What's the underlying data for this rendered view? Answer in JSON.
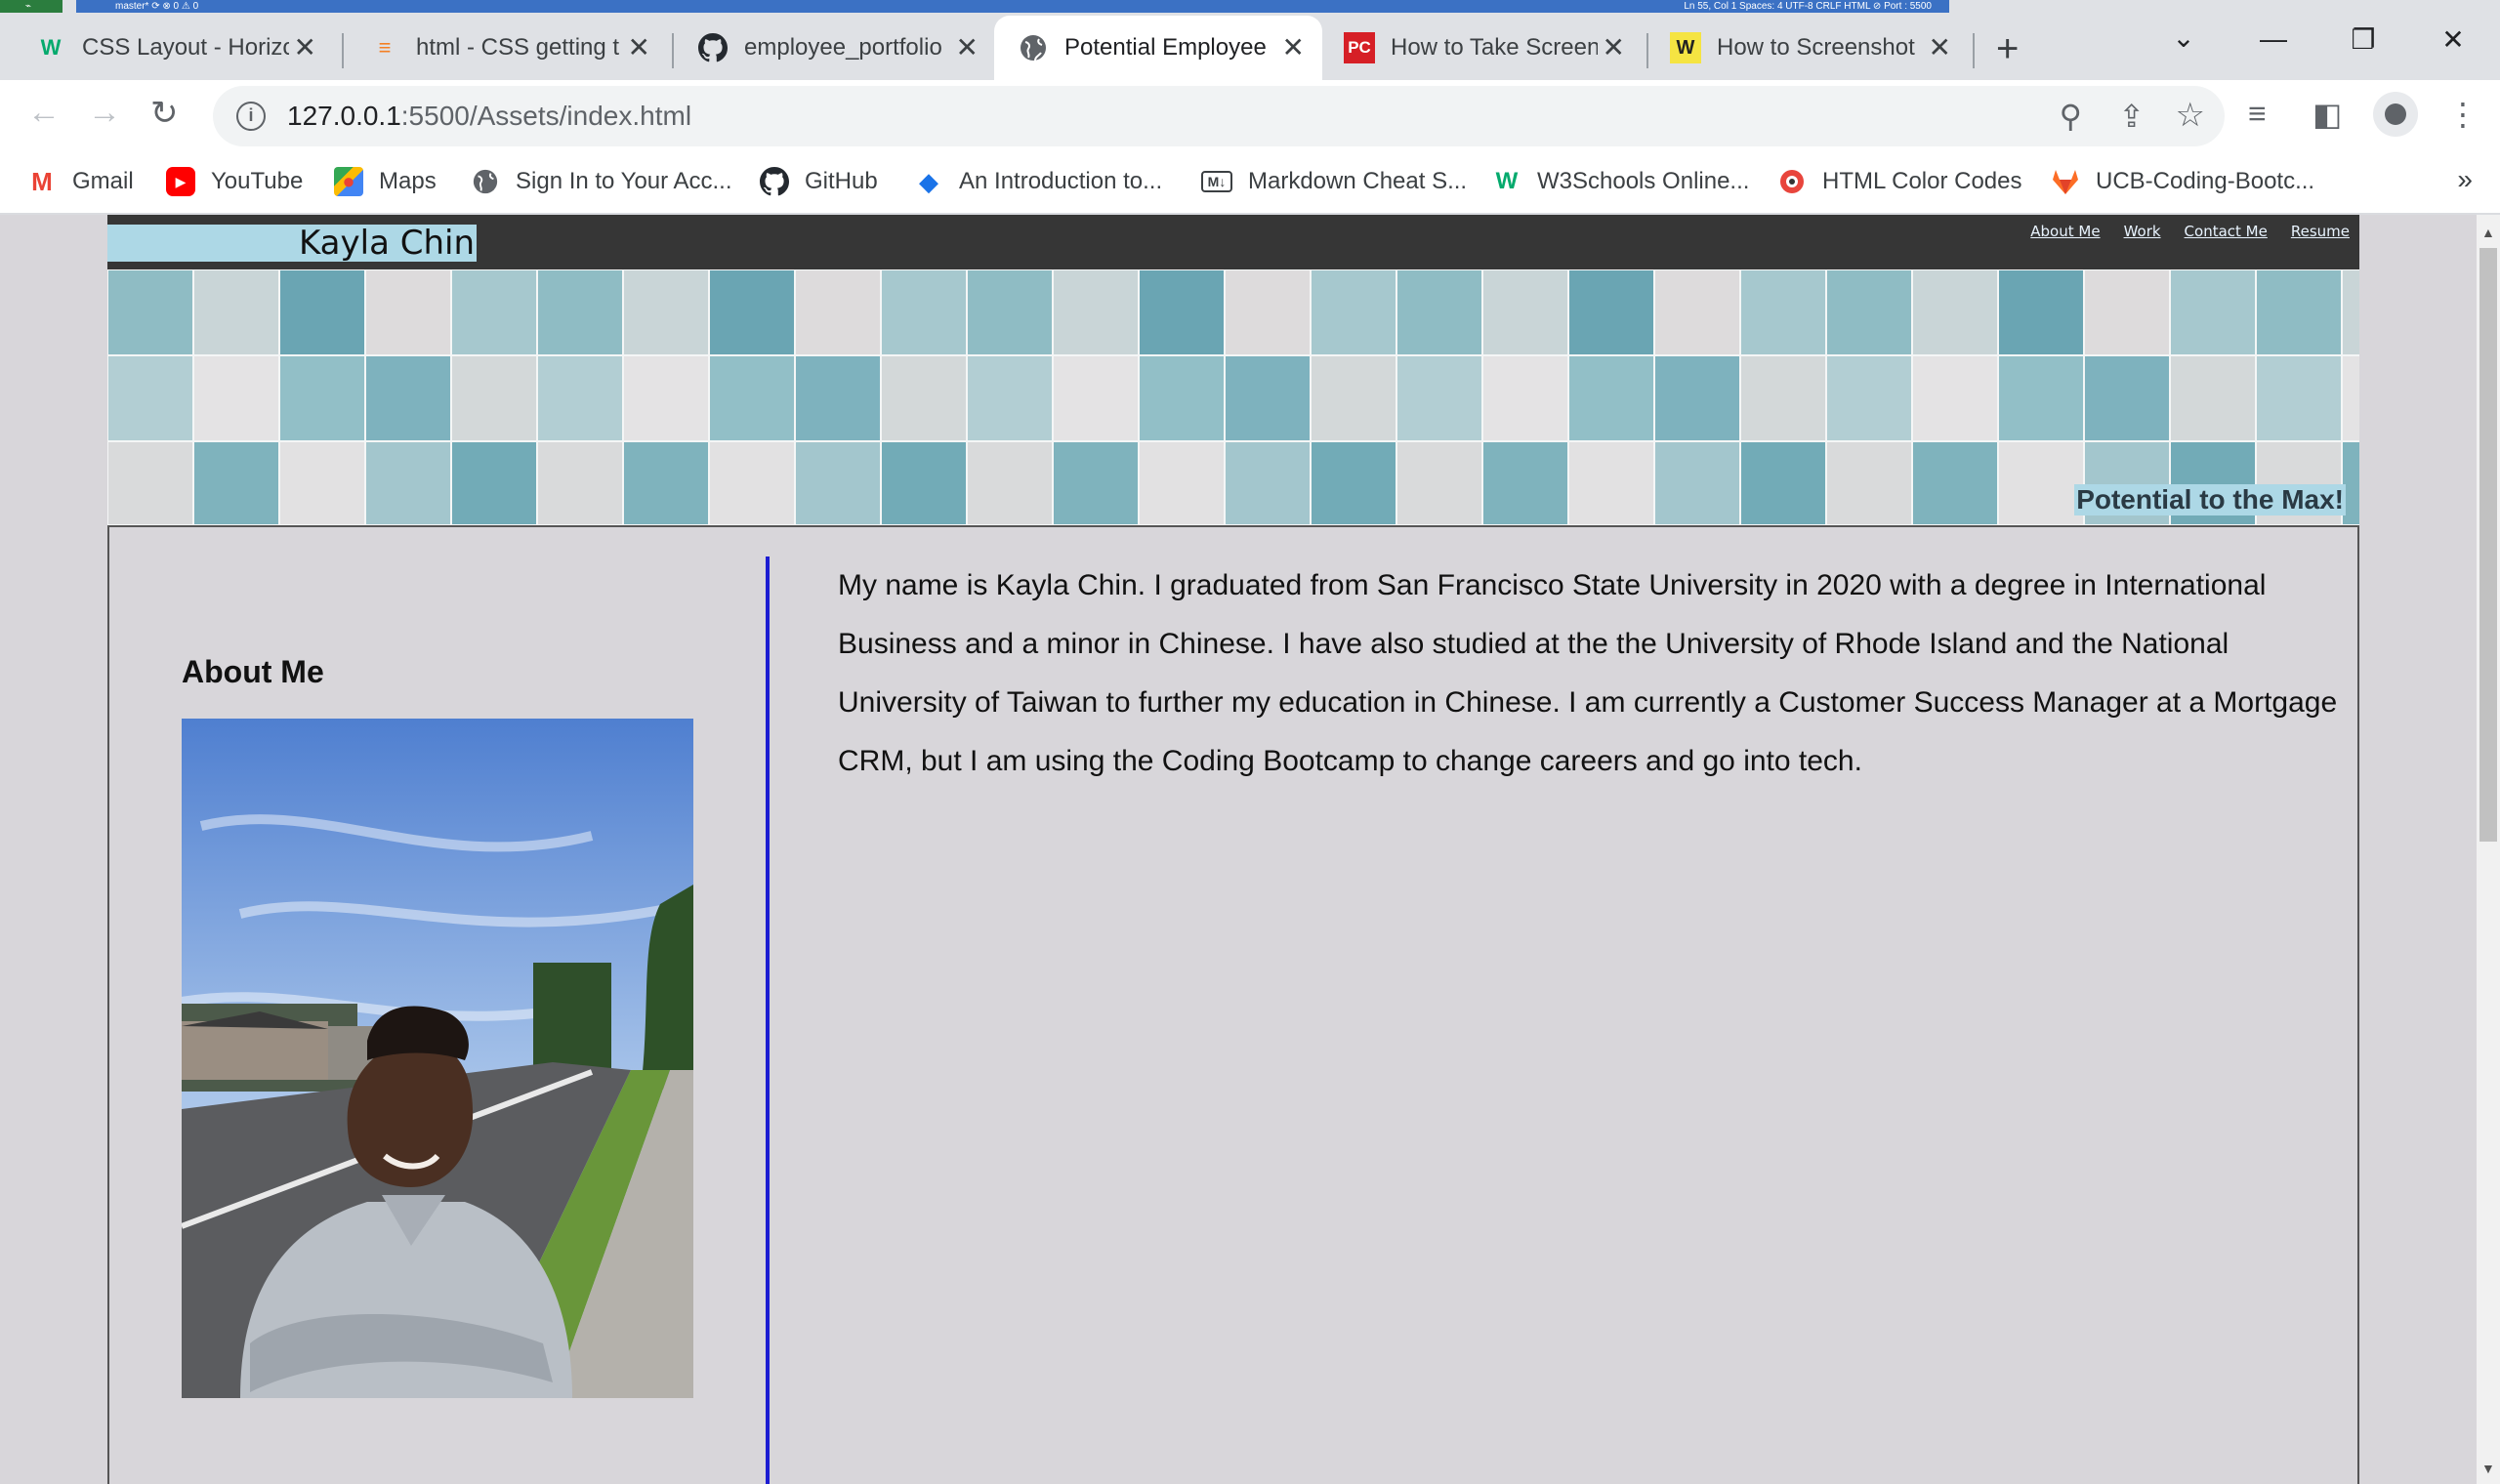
{
  "editor_status": {
    "left_branch": "master*",
    "left_counts": "⟳  ⊗ 0 ⚠ 0",
    "right": "Ln 55, Col 1    Spaces: 4    UTF-8    CRLF    HTML    ⊘ Port : 5500"
  },
  "tabs": [
    {
      "title": "CSS Layout - Horizo",
      "icon": "w3schools-icon",
      "active": false
    },
    {
      "title": "html - CSS getting t",
      "icon": "stackoverflow-icon",
      "active": false
    },
    {
      "title": "employee_portfolio",
      "icon": "github-icon",
      "active": false
    },
    {
      "title": "Potential Employee",
      "icon": "globe-icon",
      "active": true
    },
    {
      "title": "How to Take Screen",
      "icon": "pcmag-icon",
      "active": false
    },
    {
      "title": "How to Screenshot",
      "icon": "wikihow-icon",
      "active": false
    }
  ],
  "address": {
    "host": "127.0.0.1",
    "rest": ":5500/Assets/index.html"
  },
  "bookmarks": [
    {
      "label": "Gmail",
      "icon": "gmail-icon"
    },
    {
      "label": "YouTube",
      "icon": "youtube-icon"
    },
    {
      "label": "Maps",
      "icon": "maps-icon"
    },
    {
      "label": "Sign In to Your Acc...",
      "icon": "globe-icon"
    },
    {
      "label": "GitHub",
      "icon": "github-icon"
    },
    {
      "label": "An Introduction to...",
      "icon": "bookmark-icon"
    },
    {
      "label": "Markdown Cheat S...",
      "icon": "markdown-icon"
    },
    {
      "label": "W3Schools Online...",
      "icon": "w3schools-icon"
    },
    {
      "label": "HTML Color Codes",
      "icon": "colorcodes-icon"
    },
    {
      "label": "UCB-Coding-Bootc...",
      "icon": "gitlab-icon"
    }
  ],
  "site": {
    "name": "Kayla Chin",
    "nav": [
      "About Me",
      "Work",
      "Contact Me",
      "Resume"
    ],
    "tagline": "Potential to the Max!",
    "about_heading": "About Me",
    "bio": "My name is Kayla Chin. I graduated from San Francisco State University in 2020 with a degree in International Business and a minor in Chinese. I have also studied at the the University of Rhode Island and the National University of Taiwan to further my education in Chinese. I am currently a Customer Success Manager at a Mortgage CRM, but I am using the Coding Bootcamp to change careers and go into tech."
  },
  "colors": {
    "header_bg": "#363636",
    "name_highlight": "#add8e6",
    "divider": "#1c1cd2",
    "page_bg": "#d8d6da"
  }
}
